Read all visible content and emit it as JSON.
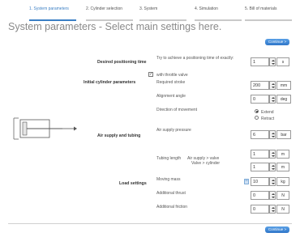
{
  "tabs": [
    {
      "label": "1. System parameters",
      "active": true
    },
    {
      "label": "2. Cylinder selection",
      "active": false
    },
    {
      "label": "3. System",
      "active": false
    },
    {
      "label": "4. Simulation",
      "active": false
    },
    {
      "label": "5. Bill of materials",
      "active": false
    }
  ],
  "page_title": "System parameters - Select main settings here.",
  "continue_label": "Continue >",
  "sections": {
    "positioning": {
      "label": "Desired positioning time",
      "hint": "Try to achieve a positioning time of exactly:",
      "value": "1",
      "unit": "s",
      "throttle_label": "with throttle valve",
      "throttle_checked": true
    },
    "cylinder": {
      "label": "Initial cylinder parameters",
      "stroke_label": "Required stroke",
      "stroke_value": "200",
      "stroke_unit": "mm",
      "angle_label": "Alignment angle",
      "angle_value": "0",
      "angle_unit": "deg",
      "direction_label": "Direction of movement",
      "direction_options": [
        "Extend",
        "Retract"
      ],
      "direction_selected": "Extend"
    },
    "air": {
      "label": "Air supply and tubing",
      "pressure_label": "Air supply pressure",
      "pressure_value": "6",
      "pressure_unit": "bar",
      "tubing_label": "Tubing length",
      "tubing_supply_label": "Air supply > valve",
      "tubing_cyl_label": "Valve > cylinder",
      "tubing_supply_value": "1",
      "tubing_cyl_value": "1",
      "tubing_unit": "m"
    },
    "load": {
      "label": "Load settings",
      "mass_label": "Moving mass",
      "mass_value": "10",
      "mass_unit": "kg",
      "thrust_label": "Additional thrust",
      "thrust_value": "0",
      "thrust_unit": "N",
      "friction_label": "Additional friction",
      "friction_value": "0",
      "friction_unit": "N"
    }
  },
  "colors": {
    "accent": "#3b7fc4",
    "title": "#8a8a8a"
  }
}
